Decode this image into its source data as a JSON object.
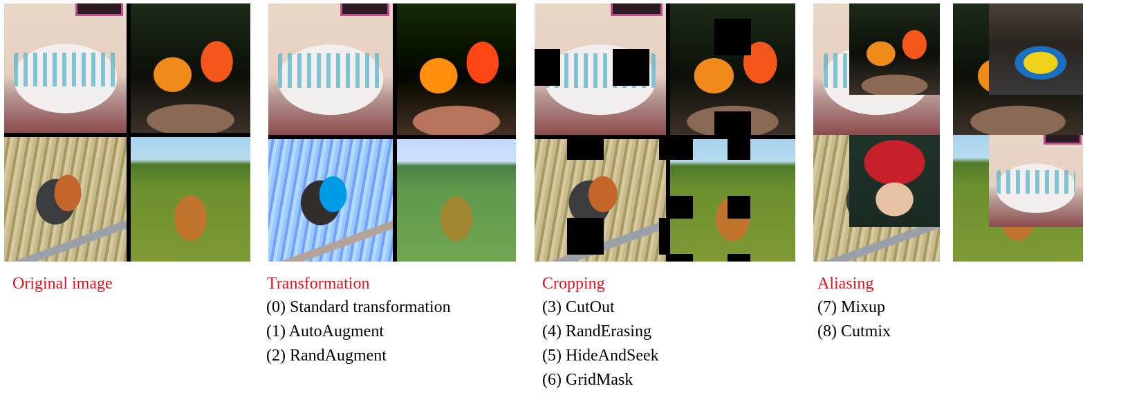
{
  "figure": {
    "panels": [
      {
        "id": "original",
        "heading": "Original image",
        "items": []
      },
      {
        "id": "transformation",
        "heading": "Transformation",
        "items": [
          "(0) Standard transformation",
          "(1) AutoAugment",
          "(2) RandAugment"
        ]
      },
      {
        "id": "cropping",
        "heading": "Cropping",
        "items": [
          "(3) CutOut",
          "(4) RandErasing",
          "(5) HideAndSeek",
          "(6) GridMask"
        ]
      },
      {
        "id": "aliasing",
        "heading": "Aliasing",
        "items": [
          "(7) Mixup",
          "(8) Cutmix"
        ]
      }
    ],
    "tiles": {
      "original": [
        "bowl",
        "goldfish",
        "robin",
        "dog-with-sunglasses"
      ],
      "mixup_inserts": [
        "goldfish",
        "child-in-red-hat"
      ],
      "cutmix_inserts": [
        "race-car",
        "bowl"
      ]
    },
    "colors": {
      "heading": "#e8121d",
      "item": "#000000",
      "mask": "#000000"
    }
  }
}
